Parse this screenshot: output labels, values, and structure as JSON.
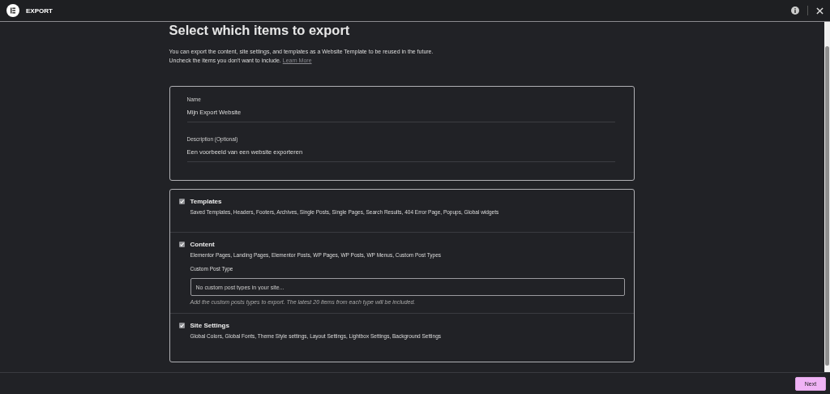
{
  "header": {
    "title": "EXPORT"
  },
  "page": {
    "title": "Select which items to export",
    "intro_line_1": "You can export the content, site settings, and templates as a Website Template to be reused in the future.",
    "intro_line_2": "Uncheck the items you don't want to include.",
    "learn_more": "Learn More"
  },
  "fields": [
    {
      "label": "Name",
      "value": "Mijn Export Website"
    },
    {
      "label": "Description (Optional)",
      "value": "Een voorbeeld van een website exporteren"
    }
  ],
  "items": [
    {
      "title": "Templates",
      "checked": true,
      "description": "Saved Templates, Headers, Footers, Archives, Single Posts, Single Pages, Search Results, 404 Error Page, Popups, Global widgets"
    },
    {
      "title": "Content",
      "checked": true,
      "description": "Elementor Pages, Landing Pages, Elementor Posts, WP Pages, WP Posts, WP Menus, Custom Post Types",
      "custom_post_type": {
        "label": "Custom Post Type",
        "placeholder": "No custom post types in your site...",
        "hint": "Add the custom posts types to export. The latest 20 items from each type will be included."
      }
    },
    {
      "title": "Site Settings",
      "checked": true,
      "description": "Global Colors, Global Fonts, Theme Style settings, Layout Settings, Lightbox Settings, Background Settings"
    }
  ],
  "footer": {
    "next_button": "Next"
  }
}
